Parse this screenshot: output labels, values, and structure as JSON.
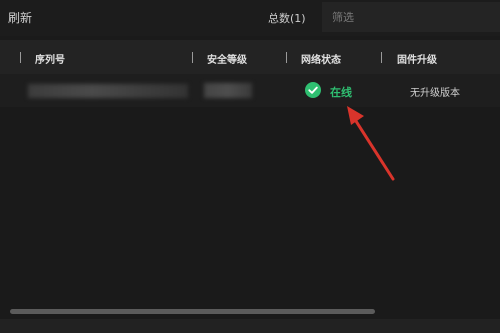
{
  "toolbar": {
    "refresh_label": "刷新",
    "total_label": "总数(1)",
    "filter_placeholder": "筛选"
  },
  "table": {
    "columns": [
      "序列号",
      "安全等级",
      "网络状态",
      "固件升级"
    ],
    "rows": [
      {
        "serial": "",
        "security_level": "",
        "network_status": "在线",
        "firmware": "无升级版本"
      }
    ]
  },
  "colors": {
    "background": "#1a1a1a",
    "status_online": "#2fbf71",
    "annotation_arrow": "#d9342b"
  },
  "icons": {
    "status": "check-circle-icon",
    "annotation": "red-arrow-icon"
  }
}
